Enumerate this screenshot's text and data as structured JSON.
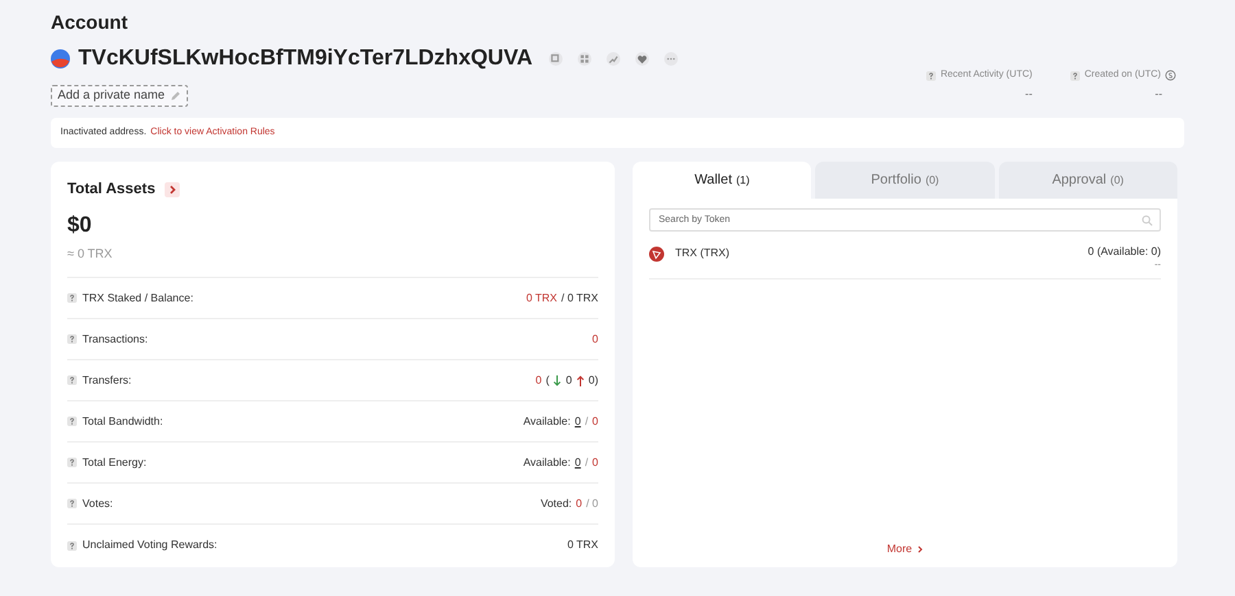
{
  "account": {
    "title": "Account",
    "address": "TVcKUfSLKwHocBfTM9iYcTer7LDzhxQUVA",
    "private_name_button": "Add a private name"
  },
  "stats": [
    {
      "label": "Recent Activity (UTC)",
      "value": "--",
      "kind": "plain"
    },
    {
      "label": "Created on (UTC)",
      "value": "--",
      "kind": "timezone"
    }
  ],
  "notice": {
    "text": "Inactivated address.",
    "link": "Click to view Activation Rules"
  },
  "total_assets": {
    "title": "Total Assets",
    "usd": "$0",
    "trx": "≈ 0 TRX",
    "rows": [
      {
        "label": "TRX Staked / Balance:",
        "value": [
          {
            "kind": "text",
            "text": "0 TRX",
            "color": "#c23631"
          },
          {
            "kind": "text",
            "text": "/ 0 TRX",
            "color": "#333333"
          }
        ]
      },
      {
        "label": "Transactions:",
        "value": [
          {
            "kind": "text",
            "text": "0",
            "color": "#c23631"
          }
        ]
      },
      {
        "label": "Transfers:",
        "value": [
          {
            "kind": "text",
            "text": "0",
            "color": "#c23631"
          },
          {
            "kind": "text",
            "text": "(",
            "color": "#333333"
          },
          {
            "kind": "down-arrow"
          },
          {
            "kind": "text",
            "text": "0",
            "color": "#333333"
          },
          {
            "kind": "up-arrow"
          },
          {
            "kind": "text",
            "text": "0)",
            "color": "#333333"
          }
        ]
      },
      {
        "label": "Total Bandwidth:",
        "value": [
          {
            "kind": "text",
            "text": "Available:",
            "color": "#333333"
          },
          {
            "kind": "text",
            "text": "0",
            "color": "#333333",
            "underline": true
          },
          {
            "kind": "text",
            "text": "/",
            "color": "#999999"
          },
          {
            "kind": "text",
            "text": "0",
            "color": "#c23631"
          }
        ]
      },
      {
        "label": "Total Energy:",
        "value": [
          {
            "kind": "text",
            "text": "Available:",
            "color": "#333333"
          },
          {
            "kind": "text",
            "text": "0",
            "color": "#333333",
            "underline": true
          },
          {
            "kind": "text",
            "text": "/",
            "color": "#999999"
          },
          {
            "kind": "text",
            "text": "0",
            "color": "#c23631"
          }
        ]
      },
      {
        "label": "Votes:",
        "value": [
          {
            "kind": "text",
            "text": "Voted:",
            "color": "#333333"
          },
          {
            "kind": "text",
            "text": "0",
            "color": "#c23631"
          },
          {
            "kind": "text",
            "text": "/ 0",
            "color": "#999999"
          }
        ]
      },
      {
        "label": "Unclaimed Voting Rewards:",
        "value": [
          {
            "kind": "text",
            "text": "0 TRX",
            "color": "#333333"
          }
        ]
      }
    ]
  },
  "tabs": [
    {
      "label": "Wallet",
      "count": "(1)",
      "selected": true
    },
    {
      "label": "Portfolio",
      "count": "(0)",
      "selected": false
    },
    {
      "label": "Approval",
      "count": "(0)",
      "selected": false
    }
  ],
  "search": {
    "placeholder": "Search by Token"
  },
  "tokens": [
    {
      "name": "TRX (TRX)",
      "amount": "0 (Available: 0)",
      "value": "--"
    }
  ],
  "more_link": "More"
}
